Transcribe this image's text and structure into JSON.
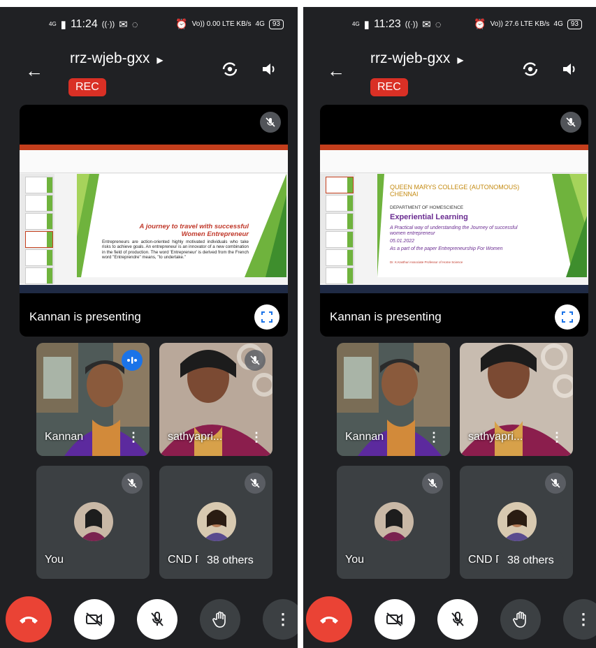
{
  "panels": [
    {
      "status": {
        "time": "11:24",
        "signal": "4G",
        "data_rate": "Vo)) 0.00 LTE KB/s",
        "net": "4G",
        "battery": "93"
      },
      "meeting": {
        "code": "rrz-wjeb-gxx",
        "rec_label": "REC"
      },
      "presentation": {
        "presenter_text": "Kannan is presenting",
        "slide_title_1": "A journey to travel with successful",
        "slide_title_2": "Women Entrepreneur",
        "slide_body": "Entrepreneurs are action-oriented highly motivated individuals who take risks to achieve goals. An entrepreneur is an innovator of a new combination in the field of production. The word 'Entrepreneur' is derived from the French word \"Entreprendre\" means, \"to undertake.\""
      },
      "tiles": [
        {
          "name": "Kannan"
        },
        {
          "name": "sathyapri..."
        },
        {
          "name": "You"
        },
        {
          "name": "CND P"
        }
      ],
      "others_label": "38 others"
    },
    {
      "status": {
        "time": "11:23",
        "signal": "4G",
        "data_rate": "Vo)) 27.6 LTE KB/s",
        "net": "4G",
        "battery": "93"
      },
      "meeting": {
        "code": "rrz-wjeb-gxx",
        "rec_label": "REC"
      },
      "presentation": {
        "presenter_text": "Kannan is presenting",
        "college": "QUEEN MARYS COLLEGE (AUTONOMOUS) CHENNAI",
        "dept": "DEPARTMENT OF HOMESCIENCE",
        "heading": "Experiential Learning",
        "line1": "A Practical way of understanding  the Journey of successful women  entrepreneur",
        "date": "05.01.2022",
        "line2": "As a part of the paper Entrepreneurship For Women",
        "line3": "Dr. K.Kasthuri Associate Professor of Home Science"
      },
      "tiles": [
        {
          "name": "Kannan"
        },
        {
          "name": "sathyapri..."
        },
        {
          "name": "You"
        },
        {
          "name": "CND P"
        }
      ],
      "others_label": "38 others"
    }
  ],
  "colors": {
    "background": "#202124",
    "tile": "#3c4043",
    "rec": "#d93025",
    "end_call": "#ea4335",
    "active_speaker": "#1a73e8"
  }
}
